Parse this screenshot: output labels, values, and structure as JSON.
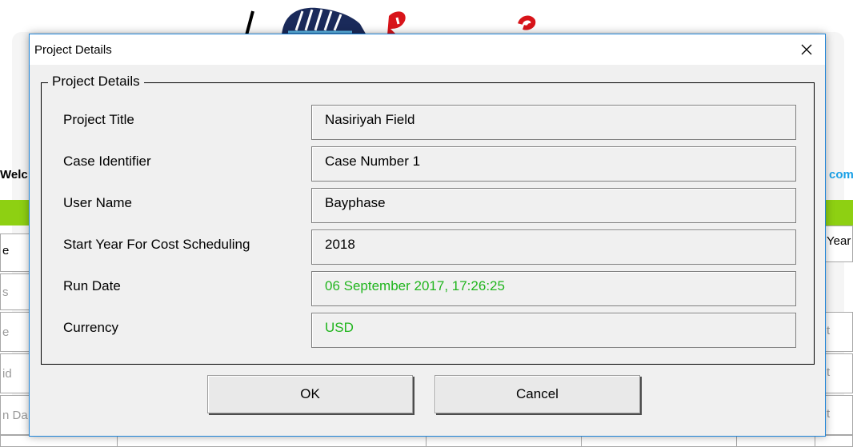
{
  "dialog": {
    "title": "Project Details",
    "group_title": "Project Details",
    "fields": [
      {
        "label": "Project Title",
        "value": "Nasiriyah Field"
      },
      {
        "label": "Case Identifier",
        "value": "Case Number 1"
      },
      {
        "label": "User Name",
        "value": "Bayphase"
      },
      {
        "label": "Start Year For Cost Scheduling",
        "value": "2018"
      },
      {
        "label": "Run Date",
        "value": "06 September 2017, 17:26:25"
      },
      {
        "label": "Currency",
        "value": "USD"
      }
    ],
    "buttons": {
      "ok": "OK",
      "cancel": "Cancel"
    },
    "close_icon": "close-icon"
  },
  "background": {
    "welcome_text": "Welc",
    "right_link_text": "com",
    "column_header_left": "e",
    "column_header_right": "Year",
    "row_labels": [
      "s",
      "e",
      "id",
      "n Da"
    ],
    "row_right": [
      "t",
      "t",
      "t"
    ]
  },
  "colors": {
    "accent_border": "#1e84d8",
    "green_value": "#21b51e",
    "green_bar": "#8ed012",
    "link_blue": "#1aa0e6"
  }
}
